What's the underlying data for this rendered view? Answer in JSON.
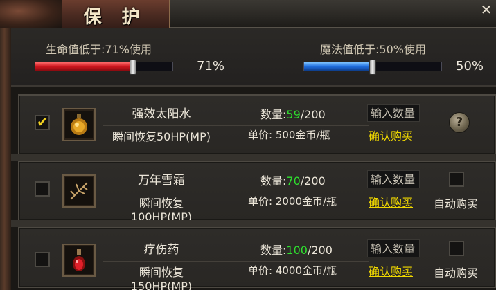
{
  "window": {
    "title": "保 护",
    "close_glyph": "✕"
  },
  "thresholds": {
    "hp": {
      "label": "生命值低于:71%使用",
      "value_text": "71%",
      "percent": 71,
      "color": "#d0161e"
    },
    "mp": {
      "label": "魔法值低于:50%使用",
      "value_text": "50%",
      "percent": 50,
      "color": "#1f6fe0"
    }
  },
  "items": [
    {
      "name": "强效太阳水",
      "effect": "瞬间恢复50HP(MP)",
      "qty_label": "数量:",
      "qty_value": "59",
      "qty_max": "/200",
      "price": "单价: 500金币/瓶",
      "input_placeholder": "输入数量",
      "buy_label": "确认购买",
      "checked": true,
      "icon": "potion-orange-icon",
      "has_help": true,
      "help_glyph": "?"
    },
    {
      "name": "万年雪霜",
      "effect": "瞬间恢复100HP(MP)",
      "qty_label": "数量:",
      "qty_value": "70",
      "qty_max": "/200",
      "price": "单价: 2000金币/瓶",
      "input_placeholder": "输入数量",
      "buy_label": "确认购买",
      "checked": false,
      "icon": "snow-branch-icon",
      "auto_buy_label": "自动购买"
    },
    {
      "name": "疗伤药",
      "effect": "瞬间恢复150HP(MP)",
      "qty_label": "数量:",
      "qty_value": "100",
      "qty_max": "/200",
      "price": "单价: 4000金币/瓶",
      "input_placeholder": "输入数量",
      "buy_label": "确认购买",
      "checked": false,
      "icon": "potion-red-icon",
      "auto_buy_label": "自动购买"
    }
  ]
}
